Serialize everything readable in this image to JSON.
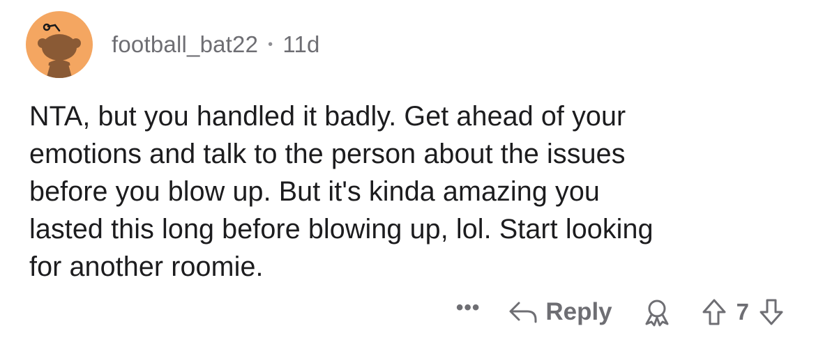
{
  "comment": {
    "username": "football_bat22",
    "separator": "•",
    "age": "11d",
    "text": "NTA, but you handled it badly.  Get ahead of your\nemotions and talk to the person about the issues\nbefore you blow up.  But it's kinda amazing you\nlasted this long before blowing up, lol.  Start looking\nfor another roomie.",
    "avatar_color": "#f4a661"
  },
  "actions": {
    "more_label": "•••",
    "reply_label": "Reply",
    "vote_count": "7",
    "icons": {
      "reply": "reply-arrow-icon",
      "award": "award-icon",
      "upvote": "upvote-arrow-icon",
      "downvote": "downvote-arrow-icon"
    }
  }
}
